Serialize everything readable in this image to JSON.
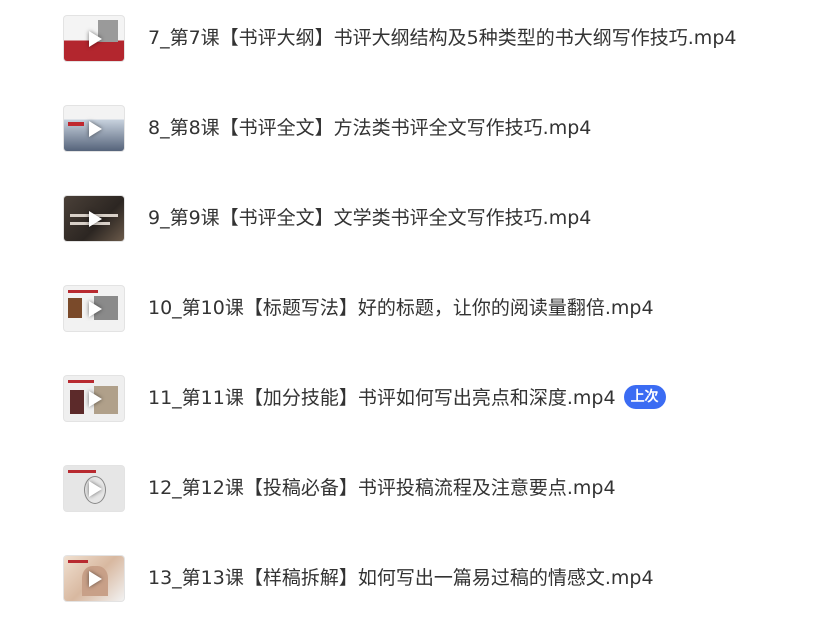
{
  "files": [
    {
      "name": "7_第7课【书评大纲】书评大纲结构及5种类型的书大纲写作技巧.mp4",
      "thumb_icon": "video-thumbnail-icon"
    },
    {
      "name": "8_第8课【书评全文】方法类书评全文写作技巧.mp4",
      "thumb_icon": "video-thumbnail-icon"
    },
    {
      "name": "9_第9课【书评全文】文学类书评全文写作技巧.mp4",
      "thumb_icon": "video-thumbnail-icon"
    },
    {
      "name": "10_第10课【标题写法】好的标题，让你的阅读量翻倍.mp4",
      "thumb_icon": "video-thumbnail-icon"
    },
    {
      "name": "11_第11课【加分技能】书评如何写出亮点和深度.mp4",
      "thumb_icon": "video-thumbnail-icon",
      "badge": "上次"
    },
    {
      "name": "12_第12课【投稿必备】书评投稿流程及注意要点.mp4",
      "thumb_icon": "video-thumbnail-icon"
    },
    {
      "name": "13_第13课【样稿拆解】如何写出一篇易过稿的情感文.mp4",
      "thumb_icon": "video-thumbnail-icon"
    }
  ],
  "colors": {
    "badge_bg": "#3b6cf3",
    "text": "#333333"
  }
}
